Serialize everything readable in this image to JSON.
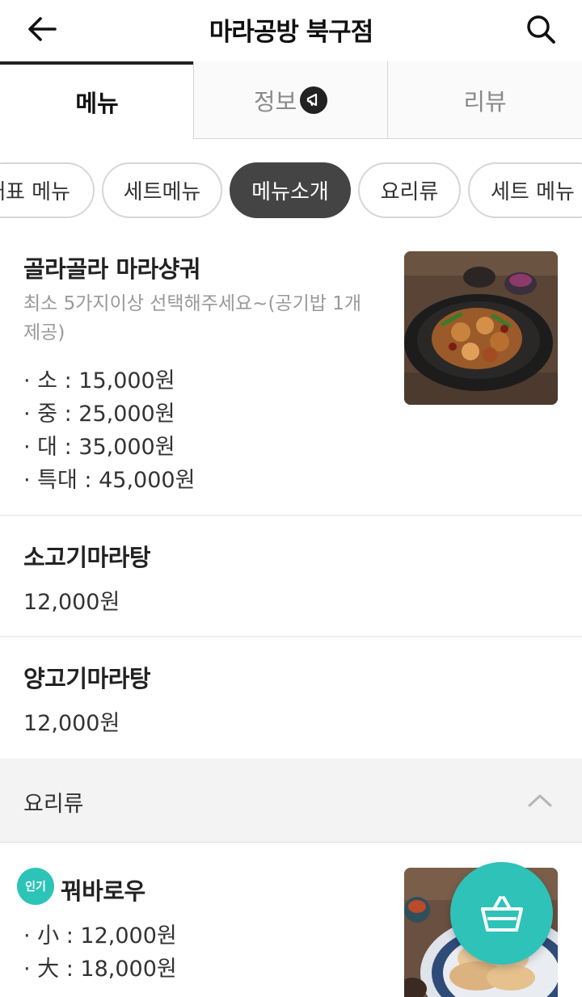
{
  "header": {
    "title": "마라공방 북구점"
  },
  "tabs": [
    {
      "label": "메뉴"
    },
    {
      "label": "정보"
    },
    {
      "label": "리뷰"
    }
  ],
  "chips": [
    {
      "label": "대표 메뉴"
    },
    {
      "label": "세트메뉴"
    },
    {
      "label": "메뉴소개"
    },
    {
      "label": "요리류"
    },
    {
      "label": "세트 메뉴"
    }
  ],
  "menu_items": [
    {
      "name": "골라골라 마라샹궈",
      "description": "최소 5가지이상 선택해주세요~(공기밥 1개 제공)",
      "options": [
        {
          "label": "· 소 : 15,000원"
        },
        {
          "label": "· 중 : 25,000원"
        },
        {
          "label": "· 대 : 35,000원"
        },
        {
          "label": "· 특대 : 45,000원"
        }
      ]
    },
    {
      "name": "소고기마라탕",
      "price": "12,000원"
    },
    {
      "name": "양고기마라탕",
      "price": "12,000원"
    }
  ],
  "section": {
    "title": "요리류"
  },
  "popular_item": {
    "badge": "인기",
    "name": "꿔바로우",
    "options": [
      {
        "label": "· 小 : 12,000원"
      },
      {
        "label": "· 大 : 18,000원"
      }
    ]
  },
  "colors": {
    "accent": "#2ec2b8",
    "active_chip": "#444444"
  },
  "icons": [
    "back-arrow-icon",
    "search-icon",
    "megaphone-icon",
    "chevron-up-icon",
    "basket-icon"
  ]
}
